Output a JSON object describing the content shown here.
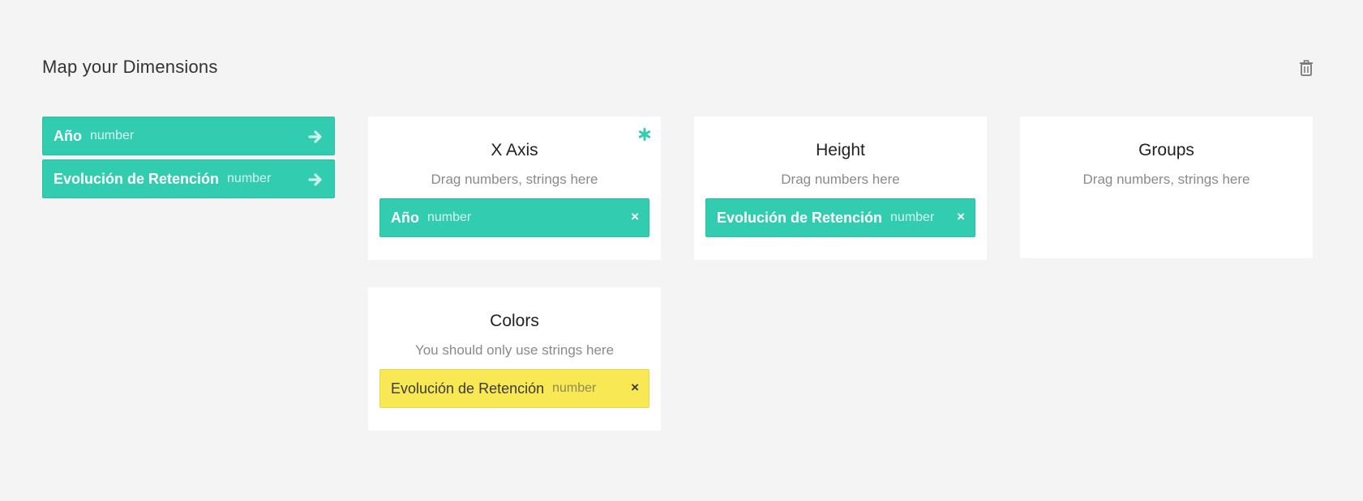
{
  "header": {
    "title": "Map your Dimensions",
    "trash_icon": "trash-icon"
  },
  "colors": {
    "accent": "#32ccb0",
    "warning": "#f8e954",
    "background": "#f4f4f4"
  },
  "sources": [
    {
      "name": "Año",
      "type": "number",
      "icon": "arrow-right-icon"
    },
    {
      "name": "Evolución de Retención",
      "type": "number",
      "icon": "arrow-right-icon"
    }
  ],
  "dimensions": {
    "x_axis": {
      "title": "X Axis",
      "hint": "Drag numbers, strings here",
      "required_icon": "asterisk-icon",
      "chip": {
        "name": "Año",
        "type": "number",
        "remove": "×"
      }
    },
    "height": {
      "title": "Height",
      "hint": "Drag numbers here",
      "chip": {
        "name": "Evolución de Retención",
        "type": "number",
        "remove": "×"
      }
    },
    "groups": {
      "title": "Groups",
      "hint": "Drag numbers, strings here"
    },
    "colors": {
      "title": "Colors",
      "hint": "You should only use strings here",
      "chip": {
        "name": "Evolución de Retención",
        "type": "number",
        "remove": "×"
      }
    }
  }
}
